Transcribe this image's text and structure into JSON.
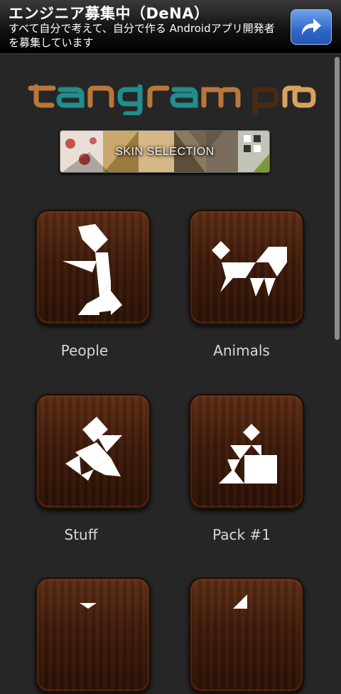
{
  "ad": {
    "title": "エンジニア募集中（DeNA）",
    "body": "すべて自分で考えて、自分で作る Androidアプリ開発者を募集しています",
    "action_icon": "share-arrow-icon"
  },
  "app": {
    "logo_text": "tangram pro",
    "skin_button_label": "SKIN SELECTION"
  },
  "categories": [
    {
      "label": "People"
    },
    {
      "label": "Animals"
    },
    {
      "label": "Stuff"
    },
    {
      "label": "Pack #1"
    }
  ],
  "colors": {
    "background": "#262626",
    "tile_wood": "#4a210c",
    "logo_brown": "#b8783a",
    "logo_teal": "#1f8f8c",
    "ad_button": "#3f7ad8"
  }
}
